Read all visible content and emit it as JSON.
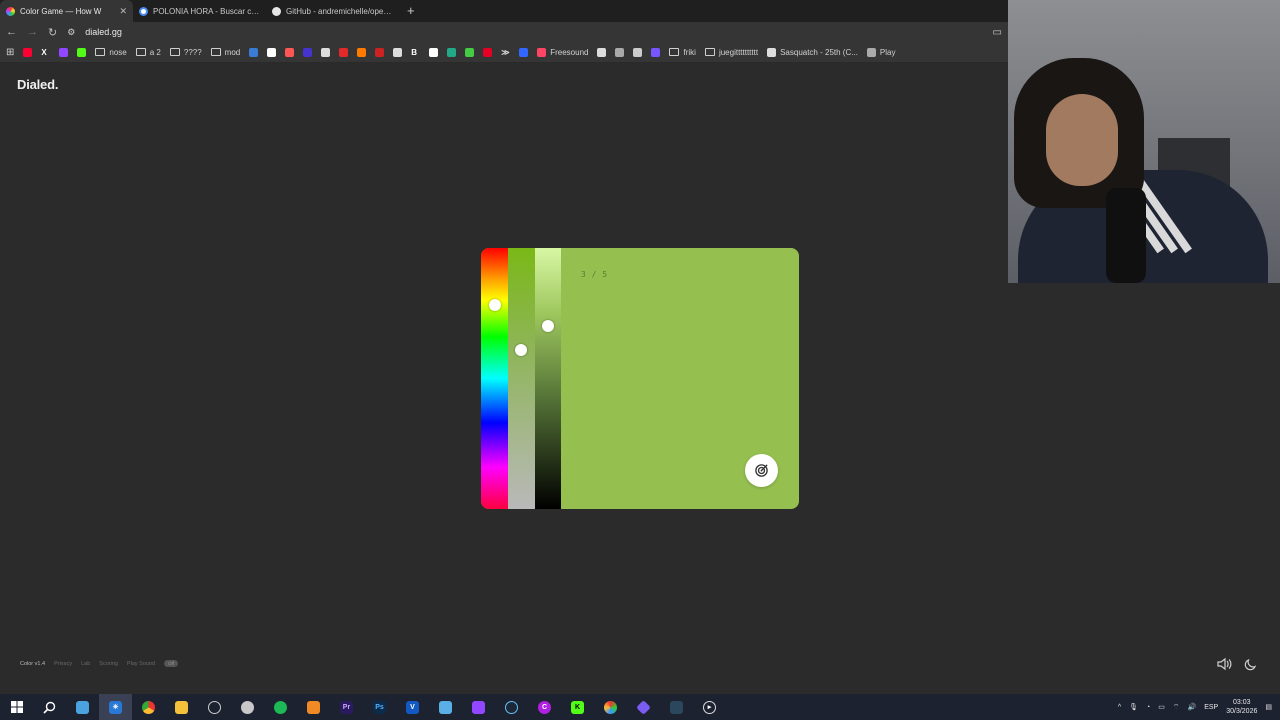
{
  "browser": {
    "tabs": [
      {
        "title": "Color Game — How W",
        "active": true,
        "fav_color": "#e8a23a"
      },
      {
        "title": "POLONIA HORA - Buscar con",
        "active": false,
        "fav_color": "#4a8af4"
      },
      {
        "title": "GitHub - andremichelle/openD",
        "active": false,
        "fav_color": "#e6e6e6"
      }
    ],
    "new_tab": "+",
    "url": "dialed.gg",
    "bookmarks": [
      {
        "label": "",
        "color": "#ff0033"
      },
      {
        "label": "",
        "color": "#ffffff",
        "glyph": "X"
      },
      {
        "label": "",
        "color": "#9146ff"
      },
      {
        "label": "",
        "color": "#53fc18"
      },
      {
        "label": "nose",
        "folder": true
      },
      {
        "label": "a 2",
        "folder": true
      },
      {
        "label": "????",
        "folder": true
      },
      {
        "label": "mod",
        "folder": true
      },
      {
        "label": "",
        "color": "#3a7bd5"
      },
      {
        "label": "",
        "color": "#ffffff"
      },
      {
        "label": "",
        "color": "#ff5555"
      },
      {
        "label": "",
        "color": "#4433cc"
      },
      {
        "label": "",
        "color": "#dddddd"
      },
      {
        "label": "",
        "color": "#e32a2a"
      },
      {
        "label": "",
        "color": "#ff7a00"
      },
      {
        "label": "",
        "color": "#cc2222"
      },
      {
        "label": "",
        "color": "#dddddd"
      },
      {
        "label": "",
        "color": "#ffffff",
        "glyph": "B"
      },
      {
        "label": "",
        "color": "#ffffff"
      },
      {
        "label": "",
        "color": "#22aa88"
      },
      {
        "label": "",
        "color": "#44cc44"
      },
      {
        "label": "",
        "color": "#e60023"
      },
      {
        "label": "",
        "color": "#dddddd",
        "glyph": "≫"
      },
      {
        "label": "",
        "color": "#3366ff"
      },
      {
        "label": "Freesound",
        "color": "#ff4466"
      },
      {
        "label": "",
        "color": "#dddddd"
      },
      {
        "label": "",
        "color": "#aaaaaa"
      },
      {
        "label": "",
        "color": "#cccccc"
      },
      {
        "label": "",
        "color": "#7755ff"
      },
      {
        "label": "friki",
        "folder": true
      },
      {
        "label": "juegitttttttttt",
        "folder": true
      },
      {
        "label": "Sasquatch - 25th (C...",
        "color": "#dddddd"
      },
      {
        "label": "Play",
        "color": "#aaaaaa"
      }
    ]
  },
  "page": {
    "logo": "Dialed.",
    "counter": "3 / 5",
    "target_color": "#95c050",
    "picker": {
      "hue_level": 0.22,
      "saturation_level": 0.39,
      "lightness_level": 0.3
    },
    "footer": {
      "version": "Color v1.4",
      "links": [
        "Privacy",
        "Lab",
        "Scoring",
        "Play Sound"
      ],
      "toggle": "Off"
    }
  },
  "taskbar": {
    "lang": "ESP",
    "time": "03:03",
    "date": "30/3/2026"
  }
}
